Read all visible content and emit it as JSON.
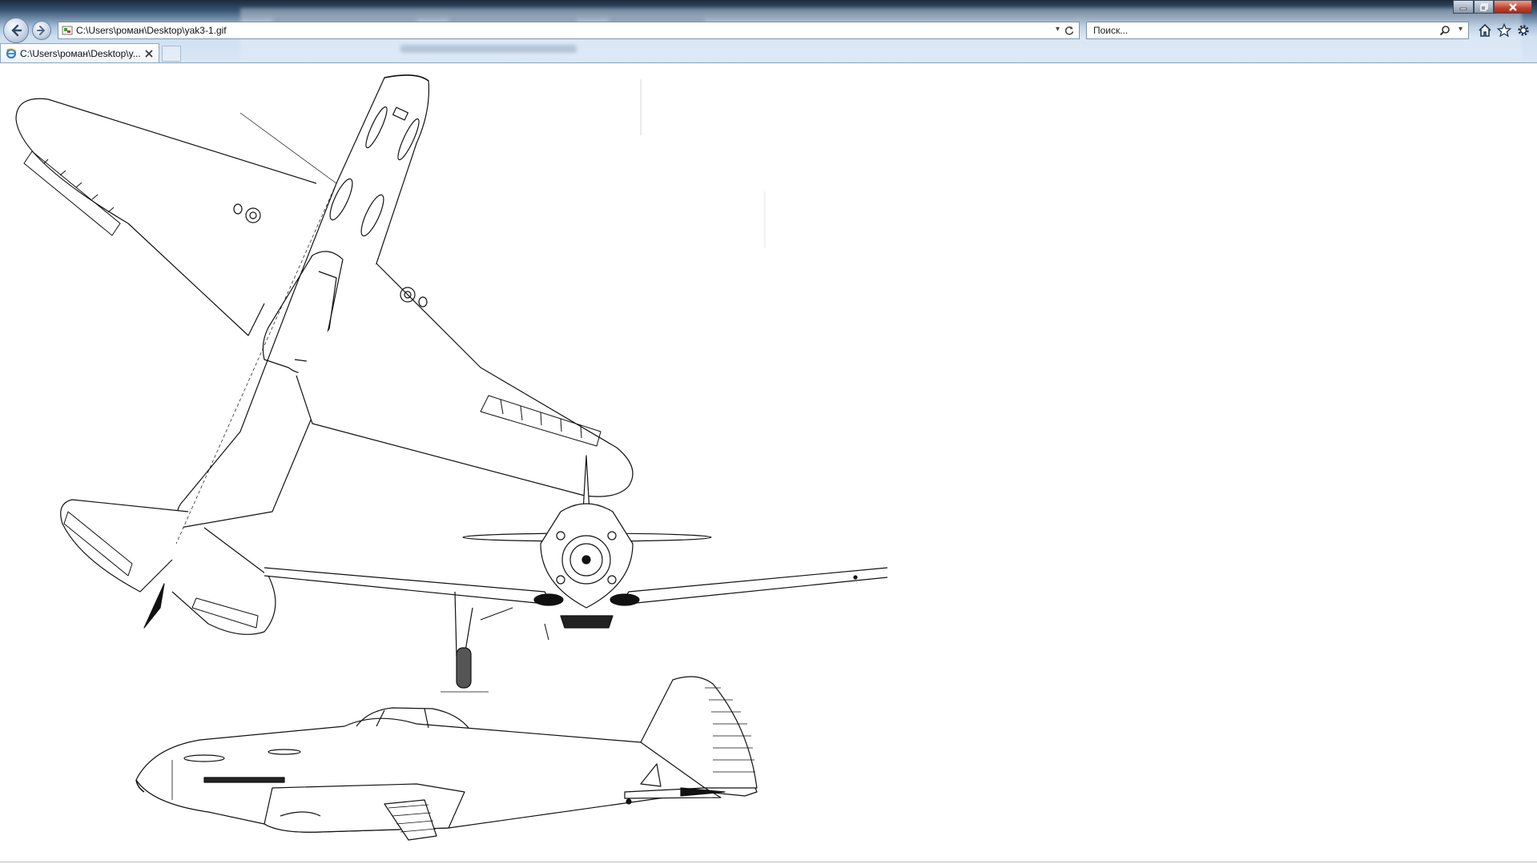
{
  "window": {
    "minimize_icon": "minimize-icon",
    "restore_icon": "restore-icon",
    "close_icon": "close-icon"
  },
  "toolbar": {
    "address": "C:\\Users\\роман\\Desktop\\yak3-1.gif",
    "search_placeholder": "Поиск...",
    "back_icon": "arrow-left-icon",
    "forward_icon": "arrow-right-icon",
    "home_icon": "home-icon",
    "favorites_icon": "star-icon",
    "tools_icon": "gear-icon"
  },
  "tabs": [
    {
      "label": "C:\\Users\\роман\\Desktop\\y...",
      "active": true
    }
  ],
  "content": {
    "image_subject": "aircraft three-view line drawing (top, front, side)"
  }
}
